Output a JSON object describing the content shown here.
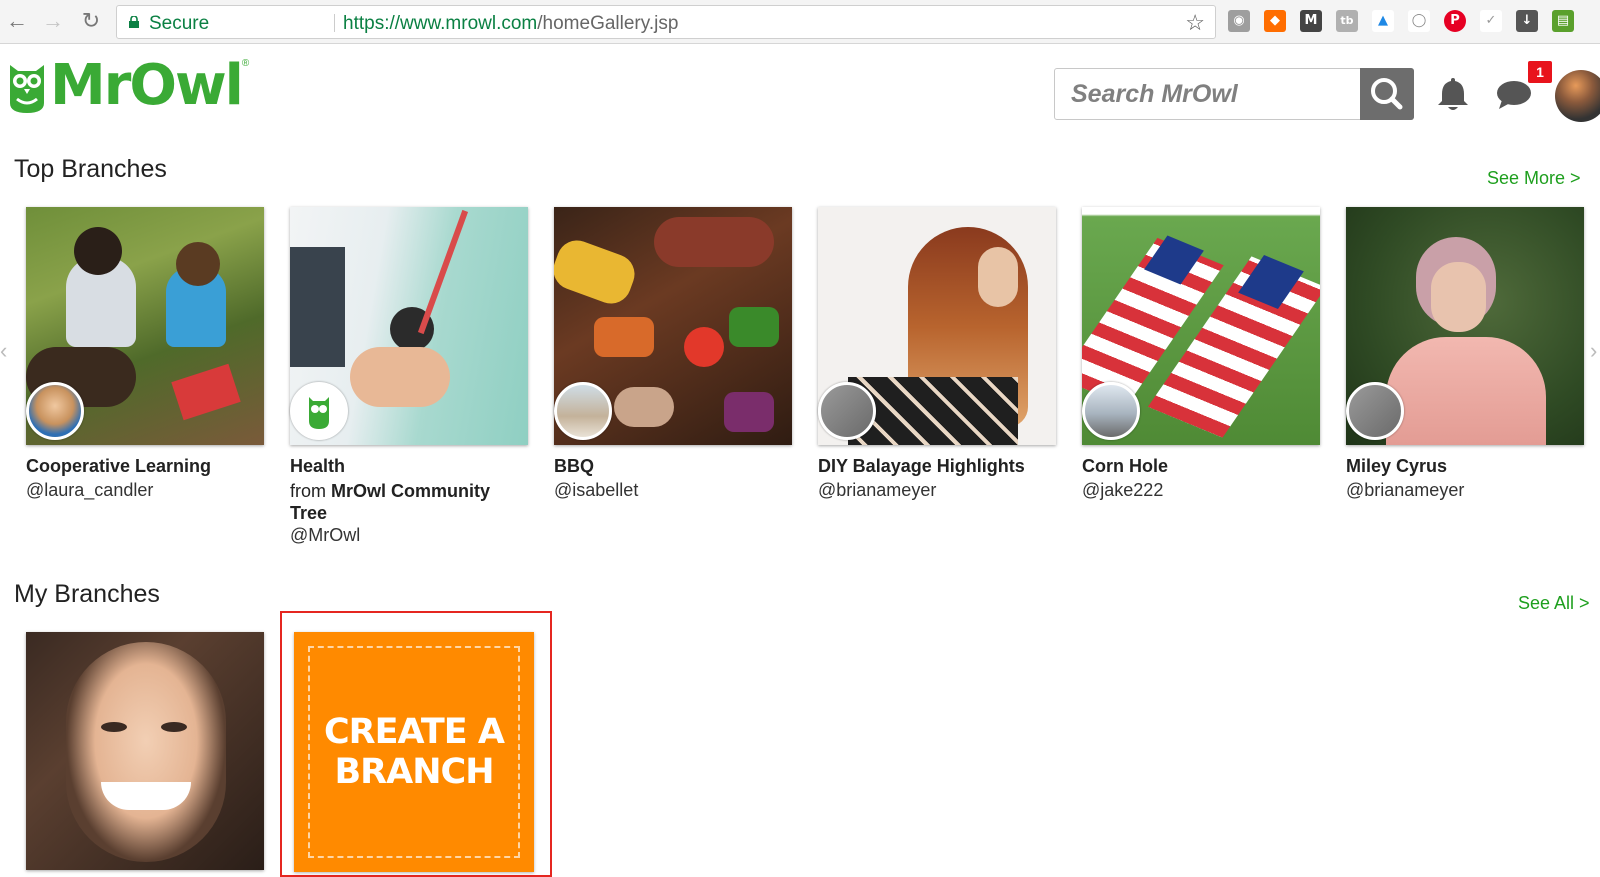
{
  "browser": {
    "secure_label": "Secure",
    "url_host": "https://www.mrowl.com",
    "url_path": "/homeGallery.jsp"
  },
  "header": {
    "logo_text": "MrOwl",
    "logo_reg": "®",
    "search_placeholder": "Search MrOwl",
    "notification_count": "1"
  },
  "top_branches": {
    "title": "Top Branches",
    "see_more": "See More >",
    "cards": [
      {
        "title": "Cooperative Learning",
        "handle": "@laura_candler"
      },
      {
        "title": "Health",
        "from_prefix": "from",
        "from_name": "MrOwl Community Tree",
        "handle": "@MrOwl"
      },
      {
        "title": "BBQ",
        "handle": "@isabellet"
      },
      {
        "title": "DIY Balayage Highlights",
        "handle": "@brianameyer"
      },
      {
        "title": "Corn Hole",
        "handle": "@jake222"
      },
      {
        "title": "Miley Cyrus",
        "handle": "@brianameyer"
      }
    ]
  },
  "my_branches": {
    "title": "My Branches",
    "see_all": "See All >",
    "create_line1": "CREATE A",
    "create_line2": "BRANCH"
  },
  "colors": {
    "brand_green": "#3aaa35",
    "link_green": "#1e9f1e",
    "create_orange": "#ff8a00",
    "highlight_red": "#e52620",
    "badge_red": "#e8141c"
  }
}
